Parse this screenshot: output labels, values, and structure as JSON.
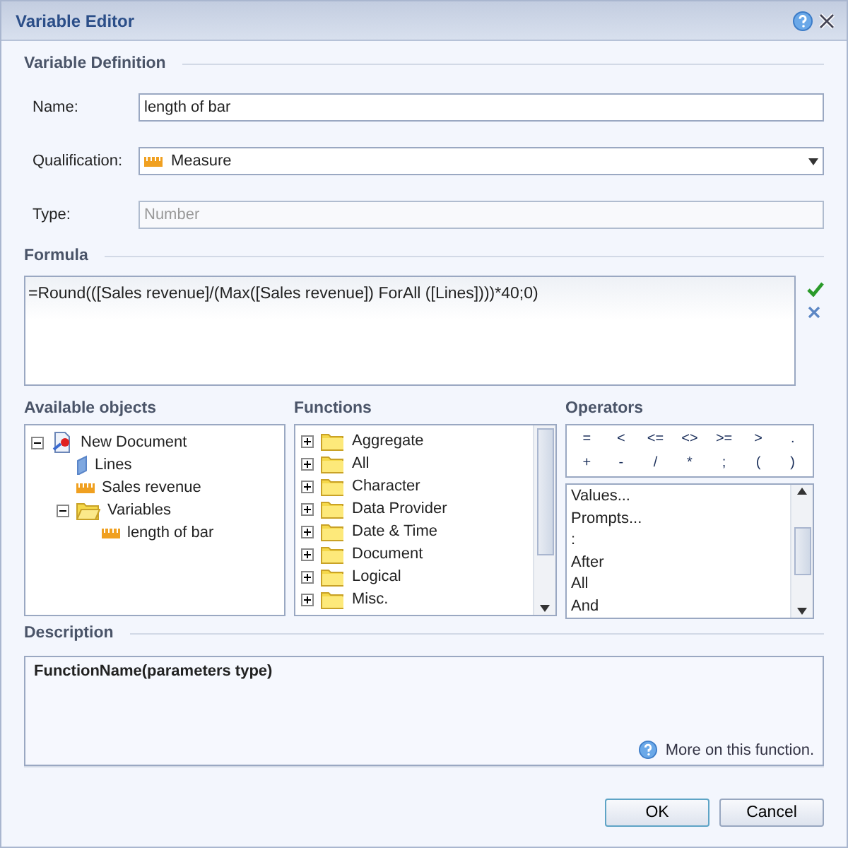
{
  "window": {
    "title": "Variable Editor"
  },
  "definition": {
    "heading": "Variable Definition",
    "fields": [
      {
        "kind": "text",
        "label": "Name:",
        "value": "length of bar"
      },
      {
        "kind": "select",
        "label": "Qualification:",
        "value": "Measure"
      },
      {
        "kind": "readonly",
        "label": "Type:",
        "placeholder": "Number"
      }
    ]
  },
  "formula": {
    "heading": "Formula",
    "value": "=Round(([Sales revenue]/(Max([Sales revenue]) ForAll ([Lines])))*40;0)"
  },
  "available_objects": {
    "heading": "Available objects",
    "tree": [
      {
        "label": "New Document",
        "kind": "document",
        "expanded": true,
        "children": [
          {
            "label": "Lines",
            "kind": "dimension"
          },
          {
            "label": "Sales revenue",
            "kind": "measure"
          },
          {
            "label": "Variables",
            "kind": "folder",
            "expanded": true,
            "children": [
              {
                "label": "length of bar",
                "kind": "measure"
              }
            ]
          }
        ]
      }
    ]
  },
  "functions": {
    "heading": "Functions",
    "items": [
      {
        "label": "Aggregate",
        "expanded": false
      },
      {
        "label": "All",
        "expanded": false
      },
      {
        "label": "Character",
        "expanded": false
      },
      {
        "label": "Data Provider",
        "expanded": false
      },
      {
        "label": "Date & Time",
        "expanded": false
      },
      {
        "label": "Document",
        "expanded": false
      },
      {
        "label": "Logical",
        "expanded": false
      },
      {
        "label": "Misc.",
        "expanded": false
      }
    ]
  },
  "operators": {
    "heading": "Operators",
    "buttons": [
      "=",
      "<",
      "<=",
      "<>",
      ">=",
      ">",
      ".",
      "+",
      "-",
      "/",
      "*",
      ";",
      "(",
      ")"
    ],
    "items": [
      "Values...",
      "Prompts...",
      ":",
      "After",
      "All",
      "And"
    ]
  },
  "description": {
    "heading": "Description",
    "text": "FunctionName(parameters type)",
    "link": "More on this function."
  },
  "buttons": [
    "OK",
    "Cancel"
  ]
}
